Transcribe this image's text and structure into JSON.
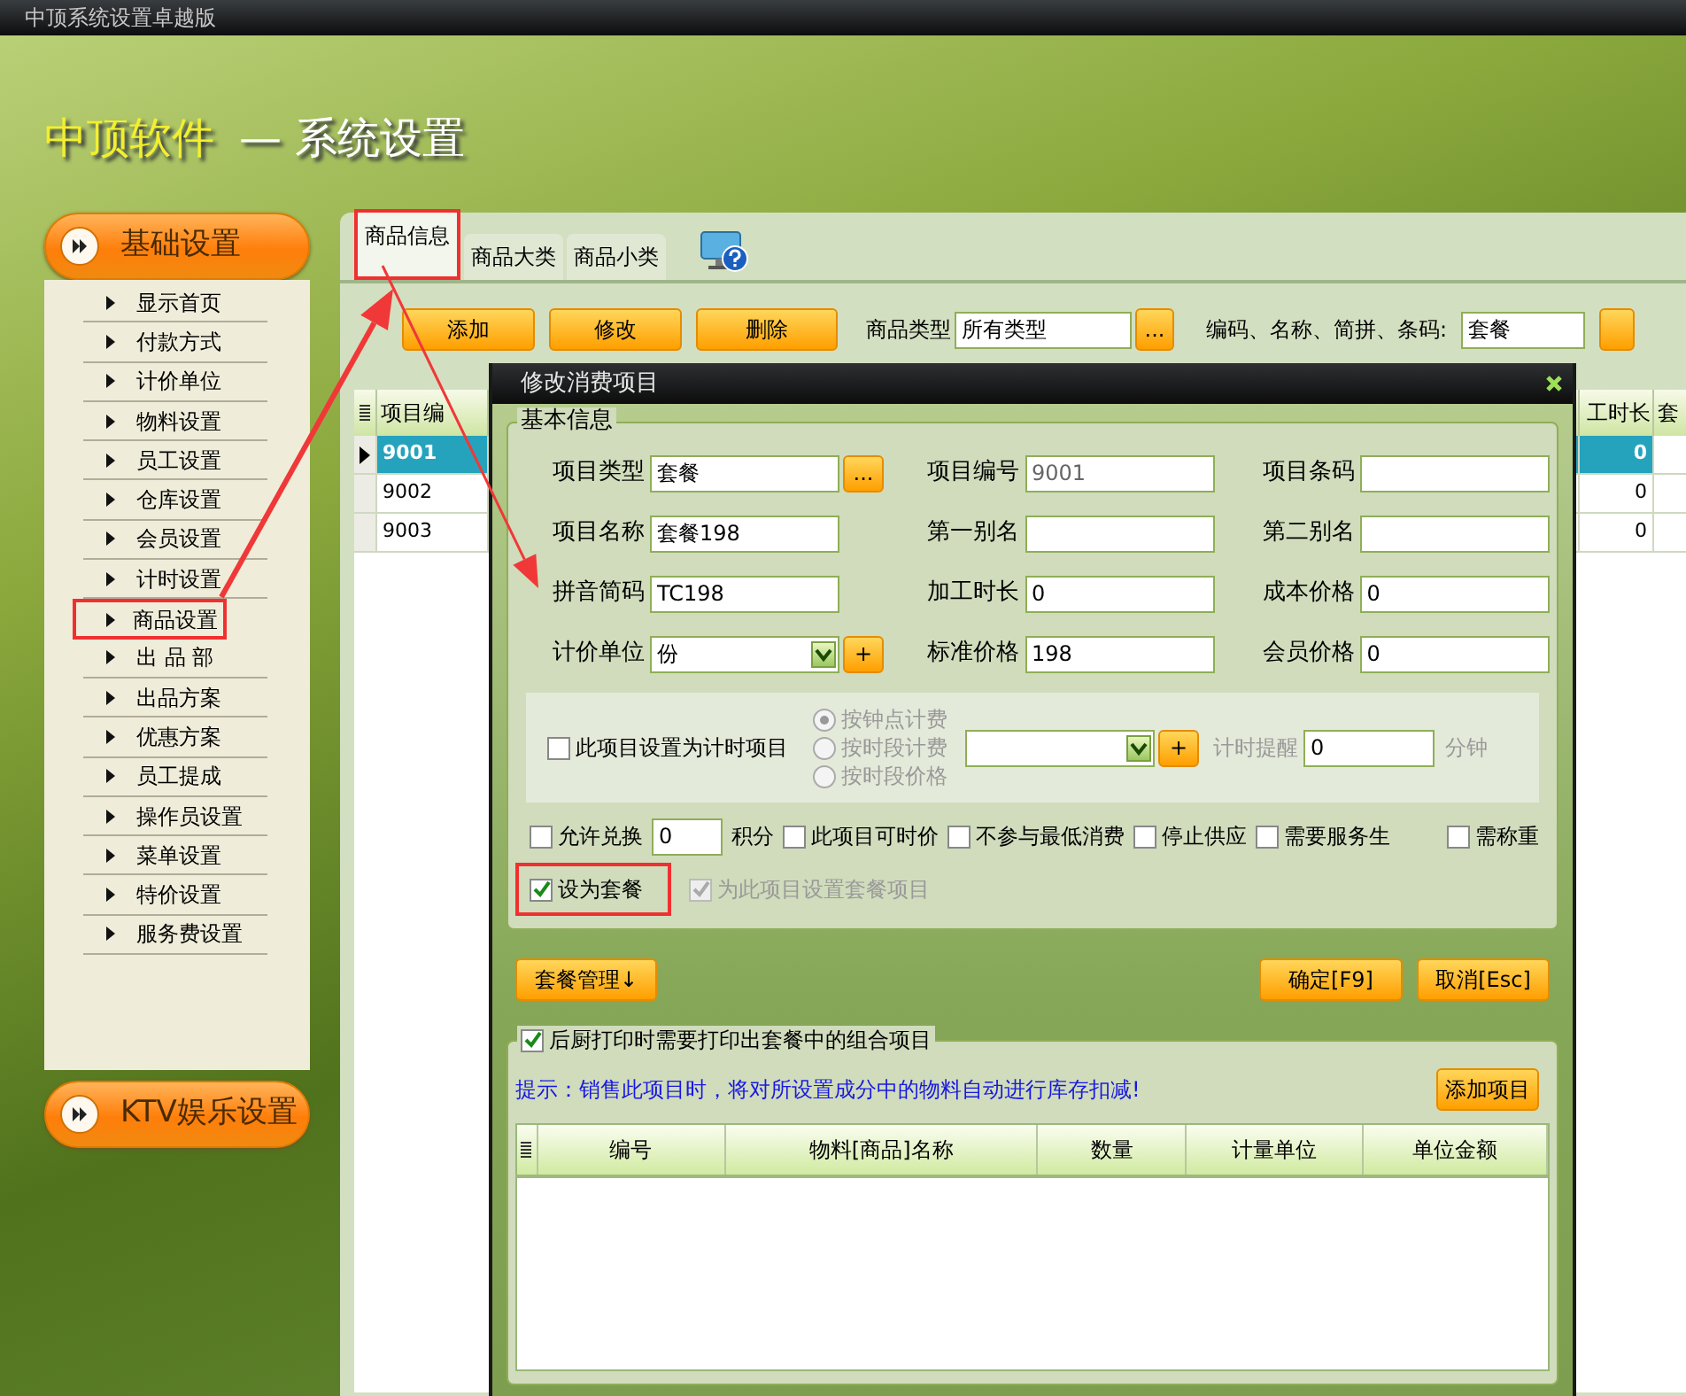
{
  "window": {
    "title": "中顶系统设置卓越版"
  },
  "header": {
    "brand": "中顶软件",
    "title": "— 系统设置"
  },
  "sidebar": {
    "sections": [
      {
        "label": "基础设置",
        "items": [
          {
            "label": "显示首页",
            "marked": false
          },
          {
            "label": "付款方式",
            "marked": false
          },
          {
            "label": "计价单位",
            "marked": false
          },
          {
            "label": "物料设置",
            "marked": false
          },
          {
            "label": "员工设置",
            "marked": false
          },
          {
            "label": "仓库设置",
            "marked": false
          },
          {
            "label": "会员设置",
            "marked": false
          },
          {
            "label": "计时设置",
            "marked": false
          },
          {
            "label": "商品设置",
            "marked": true
          },
          {
            "label": "出 品 部",
            "marked": false
          },
          {
            "label": "出品方案",
            "marked": false
          },
          {
            "label": "优惠方案",
            "marked": false
          },
          {
            "label": "员工提成",
            "marked": false
          },
          {
            "label": "操作员设置",
            "marked": false
          },
          {
            "label": "菜单设置",
            "marked": false
          },
          {
            "label": "特价设置",
            "marked": false
          },
          {
            "label": "服务费设置",
            "marked": false
          }
        ]
      },
      {
        "label": "KTV娱乐设置"
      }
    ]
  },
  "tabs": [
    {
      "label": "商品信息",
      "selected": true,
      "marked": true
    },
    {
      "label": "商品大类",
      "selected": false,
      "marked": false
    },
    {
      "label": "商品小类",
      "selected": false,
      "marked": false
    }
  ],
  "toolbar": {
    "buttons": [
      "添加",
      "修改",
      "删除"
    ],
    "type_label": "商品类型",
    "type_value": "所有类型",
    "type_button": "...",
    "search_label": "编码、名称、简拼、条码:",
    "search_value": "套餐"
  },
  "table": {
    "columns": [
      "项目编",
      "工时长",
      "套"
    ],
    "rows": [
      {
        "code": "9001",
        "column_2": "0",
        "selected": true
      },
      {
        "code": "9002",
        "column_2": "0",
        "selected": false
      },
      {
        "code": "9003",
        "column_2": "0",
        "selected": false
      }
    ]
  },
  "dialog": {
    "title": "修改消费项目",
    "basic_info": {
      "legend": "基本信息",
      "fields": [
        {
          "label": "项目类型",
          "value": "套餐",
          "kind": "picker",
          "button": "..."
        },
        {
          "label": "项目编号",
          "value": "9001",
          "kind": "readonly"
        },
        {
          "label": "项目条码",
          "kind": "text"
        },
        {
          "label": "项目名称",
          "value": "套餐198",
          "kind": "text"
        },
        {
          "label": "第一别名",
          "kind": "text"
        },
        {
          "label": "第二别名",
          "kind": "text"
        },
        {
          "label": "拼音简码",
          "value": "TC198",
          "kind": "text"
        },
        {
          "label": "加工时长",
          "value": "0",
          "kind": "text"
        },
        {
          "label": "成本价格",
          "value": "0",
          "kind": "text"
        },
        {
          "label": "计价单位",
          "value": "份",
          "kind": "dropdown",
          "button": "+"
        },
        {
          "label": "标准价格",
          "value": "198",
          "kind": "text"
        },
        {
          "label": "会员价格",
          "value": "0",
          "kind": "text"
        }
      ]
    },
    "timing": {
      "checkbox": {
        "label": "此项目设置为计时项目",
        "checked": false
      },
      "radios_disabled": true,
      "radios": [
        {
          "label": "按钟点计费",
          "selected": true
        },
        {
          "label": "按时段计费",
          "selected": false
        },
        {
          "label": "按时段价格",
          "selected": false
        }
      ],
      "add_button": "+",
      "reminder_label": "计时提醒",
      "reminder_value": "0",
      "unit": "分钟"
    },
    "options": [
      {
        "label": "允许兑换",
        "checked": false,
        "input": "0",
        "suffix": "积分"
      },
      {
        "label": "此项目可时价",
        "checked": false
      },
      {
        "label": "不参与最低消费",
        "checked": false
      },
      {
        "label": "停止供应",
        "checked": false
      },
      {
        "label": "需要服务生",
        "checked": false
      },
      {
        "label": "需称重",
        "checked": false
      }
    ],
    "package_options": [
      {
        "label": "设为套餐",
        "checked": true,
        "disabled": false,
        "marked": true
      },
      {
        "label": "为此项目设置套餐项目",
        "checked": true,
        "disabled": true,
        "marked": false
      }
    ],
    "package_button": "套餐管理↓",
    "ok_button": "确定[F9]",
    "cancel_button": "取消[Esc]",
    "components": {
      "checkbox": {
        "label": "后厨打印时需要打印出套餐中的组合项目",
        "checked": true
      },
      "hint": "提示：销售此项目时，将对所设置成分中的物料自动进行库存扣减!",
      "add_button": "添加项目",
      "columns": [
        "编号",
        "物料[商品]名称",
        "数量",
        "计量单位",
        "单位金额"
      ]
    }
  },
  "annotation_arrows": [
    {
      "kind": "thick"
    },
    {
      "kind": "thin"
    }
  ]
}
